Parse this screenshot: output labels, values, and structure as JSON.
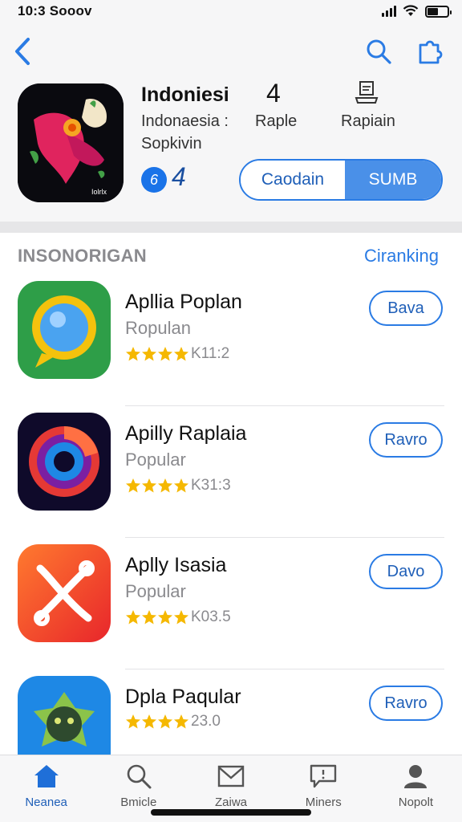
{
  "status_bar": {
    "time": "10:3 Sooov"
  },
  "header": {
    "app_title": "Indoniesi",
    "app_number": "4",
    "subtitle_left": "Indonaesia :",
    "subtitle_right": "Raple",
    "subtitle_line2": "Sopkivin",
    "report_label": "Rapiain",
    "rating_badge": "6",
    "rating_value": "4",
    "segment_left": "Caodain",
    "segment_right": "SUMB"
  },
  "section": {
    "title": "INSONORIGAN",
    "link": "Ciranking"
  },
  "apps": [
    {
      "name": "Apllia Poplan",
      "category": "Ropulan",
      "score": "K11:2",
      "button": "Bava",
      "stars": 4
    },
    {
      "name": "Apilly Raplaia",
      "category": "Popular",
      "score": "K31:3",
      "button": "Ravro",
      "stars": 4
    },
    {
      "name": "Aplly Isasia",
      "category": "Popular",
      "score": "K03.5",
      "button": "Davo",
      "stars": 4
    },
    {
      "name": "Dpla Paqular",
      "category": "",
      "score": "23.0",
      "button": "Ravro",
      "stars": 4
    }
  ],
  "tabbar": {
    "tabs": [
      {
        "label": "Neanea",
        "icon": "home-icon"
      },
      {
        "label": "Bmicle",
        "icon": "search-icon"
      },
      {
        "label": "Zaiwa",
        "icon": "mail-icon"
      },
      {
        "label": "Miners",
        "icon": "message-icon"
      },
      {
        "label": "Nopolt",
        "icon": "person-icon"
      }
    ]
  },
  "colors": {
    "accent": "#2a7be4",
    "star": "#f5b800",
    "secondary_text": "#8a8a8e"
  }
}
